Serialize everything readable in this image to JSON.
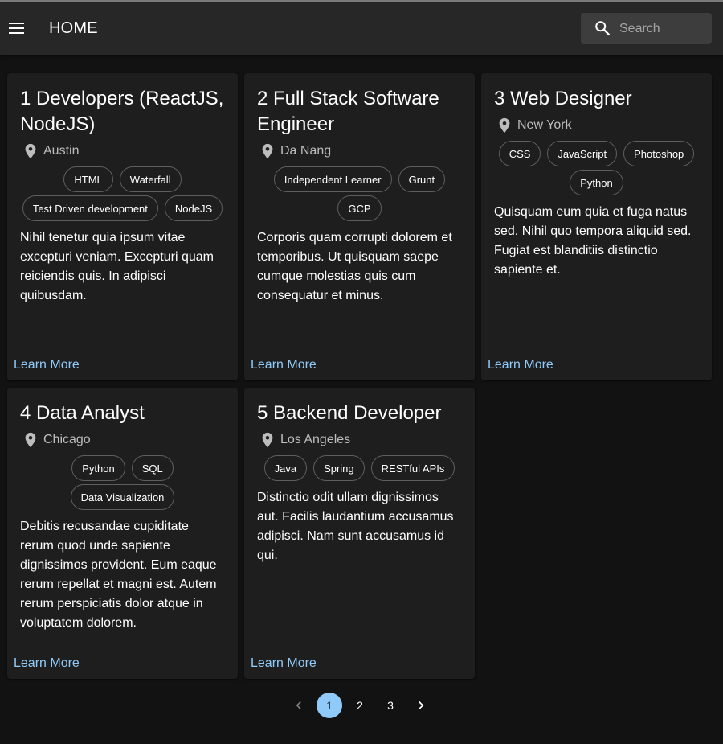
{
  "header": {
    "title": "HOME",
    "search": {
      "placeholder": "Search",
      "value": ""
    }
  },
  "jobs": [
    {
      "title": "1 Developers (ReactJS, NodeJS)",
      "location": "Austin",
      "tags": [
        "HTML",
        "Waterfall",
        "Test Driven development",
        "NodeJS"
      ],
      "description": "Nihil tenetur quia ipsum vitae excepturi veniam. Excepturi quam reiciendis quis. In adipisci quibusdam.",
      "action": "Learn More"
    },
    {
      "title": "2 Full Stack Software Engineer",
      "location": "Da Nang",
      "tags": [
        "Independent Learner",
        "Grunt",
        "GCP"
      ],
      "description": "Corporis quam corrupti dolorem et temporibus. Ut quisquam saepe cumque molestias quis cum consequatur et minus.",
      "action": "Learn More"
    },
    {
      "title": "3 Web Designer",
      "location": "New York",
      "tags": [
        "CSS",
        "JavaScript",
        "Photoshop",
        "Python"
      ],
      "description": "Quisquam eum quia et fuga natus sed. Nihil quo tempora aliquid sed. Fugiat est blanditiis distinctio sapiente et.",
      "action": "Learn More"
    },
    {
      "title": "4 Data Analyst",
      "location": "Chicago",
      "tags": [
        "Python",
        "SQL",
        "Data Visualization"
      ],
      "description": "Debitis recusandae cupiditate rerum quod unde sapiente dignissimos provident. Eum eaque rerum repellat et magni est. Autem rerum perspiciatis dolor atque in voluptatem dolorem.",
      "action": "Learn More"
    },
    {
      "title": "5 Backend Developer",
      "location": "Los Angeles",
      "tags": [
        "Java",
        "Spring",
        "RESTful APIs"
      ],
      "description": "Distinctio odit ullam dignissimos aut. Facilis laudantium accusamus adipisci. Nam sunt accusamus id qui.",
      "action": "Learn More"
    }
  ],
  "pagination": {
    "pages": [
      "1",
      "2",
      "3"
    ],
    "current": 1
  },
  "colors": {
    "background": "#121212",
    "appbar": "#272727",
    "card": "#1e1e1e",
    "accent": "#90caf9"
  },
  "icons": {
    "menu": "menu-icon",
    "search": "search-icon",
    "location": "location-pin-icon",
    "prev": "chevron-left-icon",
    "next": "chevron-right-icon"
  }
}
